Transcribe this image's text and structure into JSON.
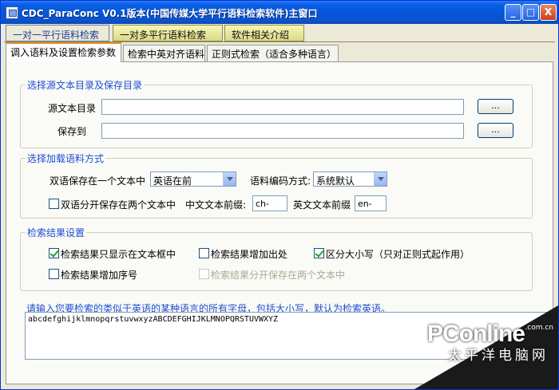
{
  "window": {
    "title": "CDC_ParaConc V0.1版本(中国传媒大学平行语料检索软件)主窗口",
    "controls": {
      "minimize": "_",
      "maximize": "□",
      "close": "X"
    }
  },
  "outer_tabs": [
    "一对一平行语料检索",
    "一对多平行语料检索",
    "软件相关介绍"
  ],
  "inner_tabs": [
    "调入语料及设置检索参数",
    "检索中英对齐语料",
    "正则式检索（适合多种语言）"
  ],
  "group_dirs": {
    "title": "选择源文本目录及保存目录",
    "source_label": "源文本目录",
    "source_value": "",
    "save_label": "保存到",
    "save_value": "",
    "browse_label": "...",
    "browse2_label": "..."
  },
  "group_load": {
    "title": "选择加载语料方式",
    "single_file_label": "双语保存在一个文本中",
    "order_value": "英语在前",
    "encoding_label": "语料编码方式:",
    "encoding_value": "系统默认",
    "split_label": "双语分开保存在两个文本中",
    "cn_prefix_label": "中文文本前缀:",
    "cn_prefix_value": "ch-",
    "en_prefix_label": "英文文本前缀",
    "en_prefix_value": "en-"
  },
  "group_results": {
    "title": "检索结果设置",
    "opt_textbox": {
      "label": "检索结果只显示在文本框中",
      "checked": true
    },
    "opt_source": {
      "label": "检索结果增加出处",
      "checked": false
    },
    "opt_case": {
      "label": "区分大小写（只对正则式起作用）",
      "checked": true
    },
    "opt_number": {
      "label": "检索结果增加序号",
      "checked": false
    },
    "opt_split": {
      "label": "检索结果分开保存在两个文本中",
      "checked": false,
      "disabled": true
    }
  },
  "alphabet": {
    "hint": "请输入您要检索的类似于英语的某种语言的所有字母，包括大小写，默认为检索英语。",
    "value": "abcdefghijklmnopqrstuvwxyzABCDEFGHIJKLMNOPQRSTUVWXYZ"
  },
  "watermark": {
    "logo": "PConline",
    "domain": ".com.cn",
    "subtitle": "太平洋电脑网"
  }
}
